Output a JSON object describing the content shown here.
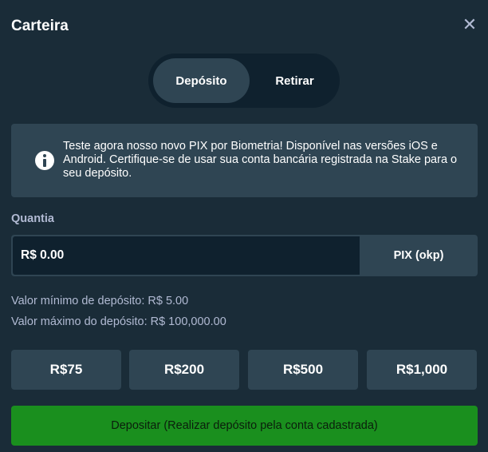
{
  "header": {
    "title": "Carteira",
    "close_icon": "close-icon",
    "close_glyph": "✕"
  },
  "tabs": [
    {
      "label": "Depósito",
      "active": true
    },
    {
      "label": "Retirar",
      "active": false
    }
  ],
  "info_banner": {
    "icon": "info-icon",
    "text": "Teste agora nosso novo PIX por Biometria! Disponível nas versões iOS e Android. Certifique-se de usar sua conta bancária registrada na Stake para o seu depósito."
  },
  "amount": {
    "label": "Quantia",
    "value": "R$ 0.00",
    "method": "PIX (okp)"
  },
  "limits": {
    "min": "Valor mínimo de depósito: R$ 5.00",
    "max": "Valor máximo do depósito: R$ 100,000.00"
  },
  "presets": [
    "R$75",
    "R$200",
    "R$500",
    "R$1,000"
  ],
  "submit_label": "Depositar (Realizar depósito pela conta cadastrada)",
  "colors": {
    "background": "#1a2c38",
    "panel": "#2f4553",
    "input_dark": "#0f212e",
    "accent_green": "#1a8f1e",
    "muted_text": "#b1bad3"
  }
}
